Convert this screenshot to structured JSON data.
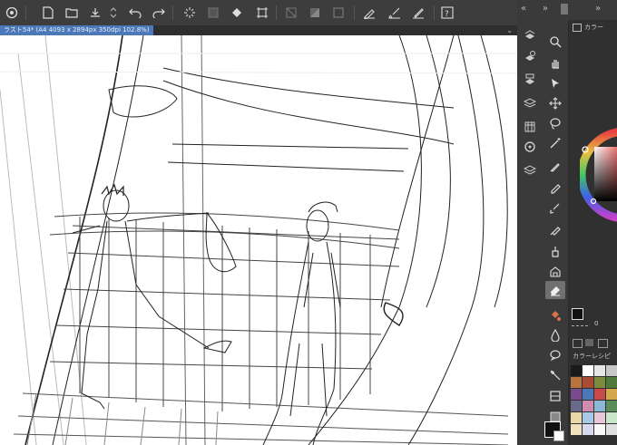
{
  "toolbar": {
    "icons": [
      "app-menu-icon",
      "new-file-icon",
      "open-folder-icon",
      "save-icon",
      "undo-icon",
      "redo-icon",
      "loading-spinner-icon",
      "clear-layer-icon",
      "fill-icon",
      "transform-icon",
      "hide-selection-icon",
      "invert-selection-icon",
      "deselect-icon",
      "pen-icon",
      "brush-icon",
      "pencil-icon",
      "help-icon"
    ]
  },
  "document": {
    "title": "ラスト54* (A4 4093 x 2894px 350dpi 102.8%)"
  },
  "right_panel": {
    "color_tab_label": "カラー",
    "palette_tab_label": "カラーレシピ",
    "value_readout": "0"
  },
  "colors": {
    "accent": "#4a78b8",
    "toolbar_bg": "#3d3d3d",
    "panel_bg": "#353535",
    "canvas_bg": "#ffffff",
    "swatches": [
      "#1a1a1a",
      "#ffffff",
      "#e6e6e6",
      "#c8c8c8",
      "#b8743c",
      "#a84c36",
      "#7d8c3c",
      "#4f7a3a",
      "#7a4a8c",
      "#4a78b8",
      "#c94848",
      "#d4a84c",
      "#6a6a8a",
      "#d08cb0",
      "#8cb8d8",
      "#5c8c5c",
      "#e8d8a8",
      "#a8c8e8",
      "#e8c8d8",
      "#c8e8c8",
      "#f0e0c0",
      "#d8d8f0",
      "#f8f8f8",
      "#e0e0e0"
    ]
  }
}
